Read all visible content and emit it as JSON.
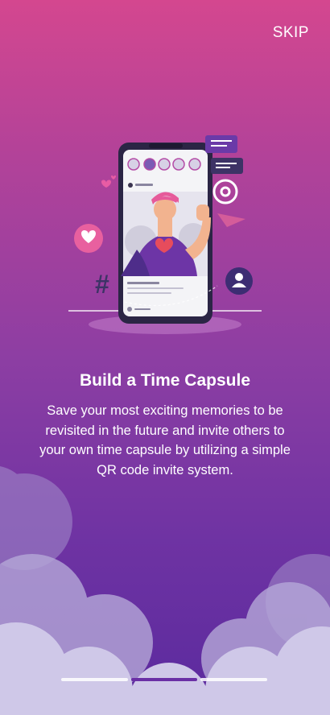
{
  "header": {
    "skip_label": "SKIP"
  },
  "onboarding": {
    "title": "Build a Time Capsule",
    "description": "Save your most exciting memories to be revisited in the future and invite others to your own time capsule by utilizing a simple QR code invite system.",
    "current_page": 2,
    "total_pages": 3
  },
  "colors": {
    "gradient_top": "#d4478f",
    "gradient_bottom": "#5a2a9e",
    "text": "#ffffff",
    "active_indicator": "#6a2fa5"
  },
  "icons": [
    "heart-icon",
    "at-sign-icon",
    "send-icon",
    "hashtag-icon",
    "user-avatar-icon",
    "chat-bubble-icon"
  ]
}
